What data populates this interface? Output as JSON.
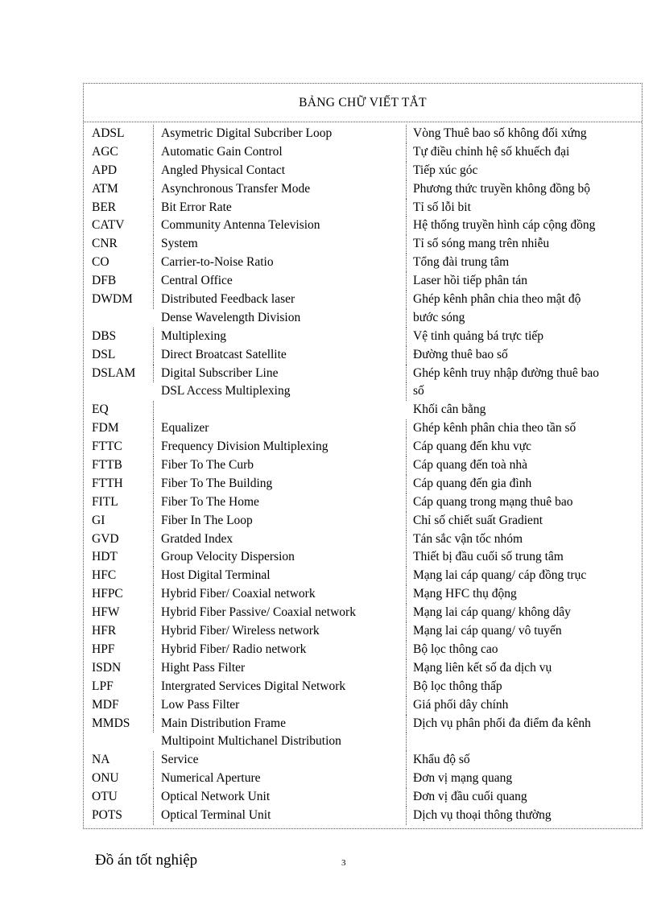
{
  "document": {
    "table_title": "BẢNG CHỮ VIẾT TẮT",
    "footer_title": "Đồ án tốt nghiệp",
    "page_number": "3"
  },
  "table": {
    "rows": [
      {
        "abbr": "ADSL",
        "en": "Asymetric Digital  Subcriber Loop",
        "vi": "Vòng Thuê bao số không đối xứng"
      },
      {
        "abbr": "AGC",
        "en": "Automatic  Gain  Control",
        "vi": "Tự  điều chỉnh hệ số khuếch đại"
      },
      {
        "abbr": "APD",
        "en": "Angled Physical Contact",
        "vi": "Tiếp xúc góc"
      },
      {
        "abbr": "ATM",
        "en": "Asynchronous Transfer Mode",
        "vi": "Phương thức truyền  không đồng bộ"
      },
      {
        "abbr": "BER",
        "en": "Bit Error Rate",
        "vi": "Tỉ số lỗi bit"
      },
      {
        "abbr": "CATV",
        "en": "Community  Antenna  Television",
        "vi": "Hệ thống truyền hình cáp cộng đồng"
      },
      {
        "abbr": "CNR",
        "en": "System",
        "vi": "Tỉ số sóng mang trên nhiễu"
      },
      {
        "abbr": "CO",
        "en": "Carrier-to-Noise Ratio",
        "vi": "Tổng đài trung tâm"
      },
      {
        "abbr": "DFB",
        "en": "Central  Office",
        "vi": "Laser hồi tiếp phân tán"
      },
      {
        "abbr": "DWDM",
        "en": "Distributed  Feedback laser",
        "vi": "Ghép kênh phân chia theo mật độ"
      },
      {
        "abbr": "",
        "en": "Dense Wavelength  Division",
        "vi": "bước sóng"
      },
      {
        "abbr": "DBS",
        "en": "Multiplexing",
        "vi": "Vệ tinh  quảng bá trực tiếp"
      },
      {
        "abbr": "DSL",
        "en": "Direct Broatcast Satellite",
        "vi": "Đường thuê bao số"
      },
      {
        "abbr": "DSLAM",
        "en": "Digital  Subscriber Line",
        "vi": "Ghép kênh truy nhập đường thuê bao"
      },
      {
        "abbr": "",
        "en": "DSL Access Multiplexing",
        "vi": "số"
      },
      {
        "abbr": "EQ",
        "en": "",
        "vi": "Khối cân bằng"
      },
      {
        "abbr": "FDM",
        "en": "Equalizer",
        "vi": "Ghép kênh phân chia theo tần số"
      },
      {
        "abbr": "FTTC",
        "en": "Frequency Division  Multiplexing",
        "vi": "Cáp quang đến khu vực"
      },
      {
        "abbr": "FTTB",
        "en": "Fiber To The Curb",
        "vi": "Cáp quang đến toà nhà"
      },
      {
        "abbr": "FTTH",
        "en": "Fiber To The Building",
        "vi": "Cáp quang đến gia đình"
      },
      {
        "abbr": "FITL",
        "en": "Fiber To The Home",
        "vi": "Cáp quang trong mạng thuê bao"
      },
      {
        "abbr": "GI",
        "en": "Fiber In The Loop",
        "vi": "Chỉ số chiết suất Gradient"
      },
      {
        "abbr": "GVD",
        "en": "Gratded Index",
        "vi": "Tán sắc vận tốc nhóm"
      },
      {
        "abbr": "HDT",
        "en": "Group Velocity Dispersion",
        "vi": "Thiết bị đầu cuối số trung tâm"
      },
      {
        "abbr": "HFC",
        "en": "Host Digital  Terminal",
        "vi": "Mạng lai cáp quang/ cáp đồng trục"
      },
      {
        "abbr": "HFPC",
        "en": "Hybrid Fiber/ Coaxial network",
        "vi": "Mạng HFC thụ động"
      },
      {
        "abbr": "HFW",
        "en": "Hybrid Fiber Passive/ Coaxial network",
        "vi": "Mạng lai cáp quang/ không dây"
      },
      {
        "abbr": "HFR",
        "en": "Hybrid Fiber/ Wireless network",
        "vi": "Mạng lai cáp quang/ vô tuyến"
      },
      {
        "abbr": "HPF",
        "en": "Hybrid Fiber/ Radio network",
        "vi": "Bộ lọc thông cao"
      },
      {
        "abbr": "ISDN",
        "en": "Hight Pass Filter",
        "vi": "Mạng liên kết số đa dịch vụ"
      },
      {
        "abbr": "LPF",
        "en": "Intergrated Services Digital  Network",
        "vi": "Bộ lọc thông thấp"
      },
      {
        "abbr": "MDF",
        "en": "Low Pass Filter",
        "vi": "Giá phối dây chính"
      },
      {
        "abbr": "MMDS",
        "en": "Main Distribution  Frame",
        "vi": "Dịch vụ phân phối đa điểm đa kênh"
      },
      {
        "abbr": "",
        "en": "Multipoint  Multichanel  Distribution",
        "vi": ""
      },
      {
        "abbr": "NA",
        "en": "Service",
        "vi": "Khẩu độ số"
      },
      {
        "abbr": "ONU",
        "en": "Numerical  Aperture",
        "vi": "Đơn vị mạng quang"
      },
      {
        "abbr": "OTU",
        "en": "Optical Network Unit",
        "vi": "Đơn vị đầu cuối quang"
      },
      {
        "abbr": "POTS",
        "en": "Optical Terminal  Unit",
        "vi": "Dịch vụ thoại thông thường"
      }
    ]
  }
}
